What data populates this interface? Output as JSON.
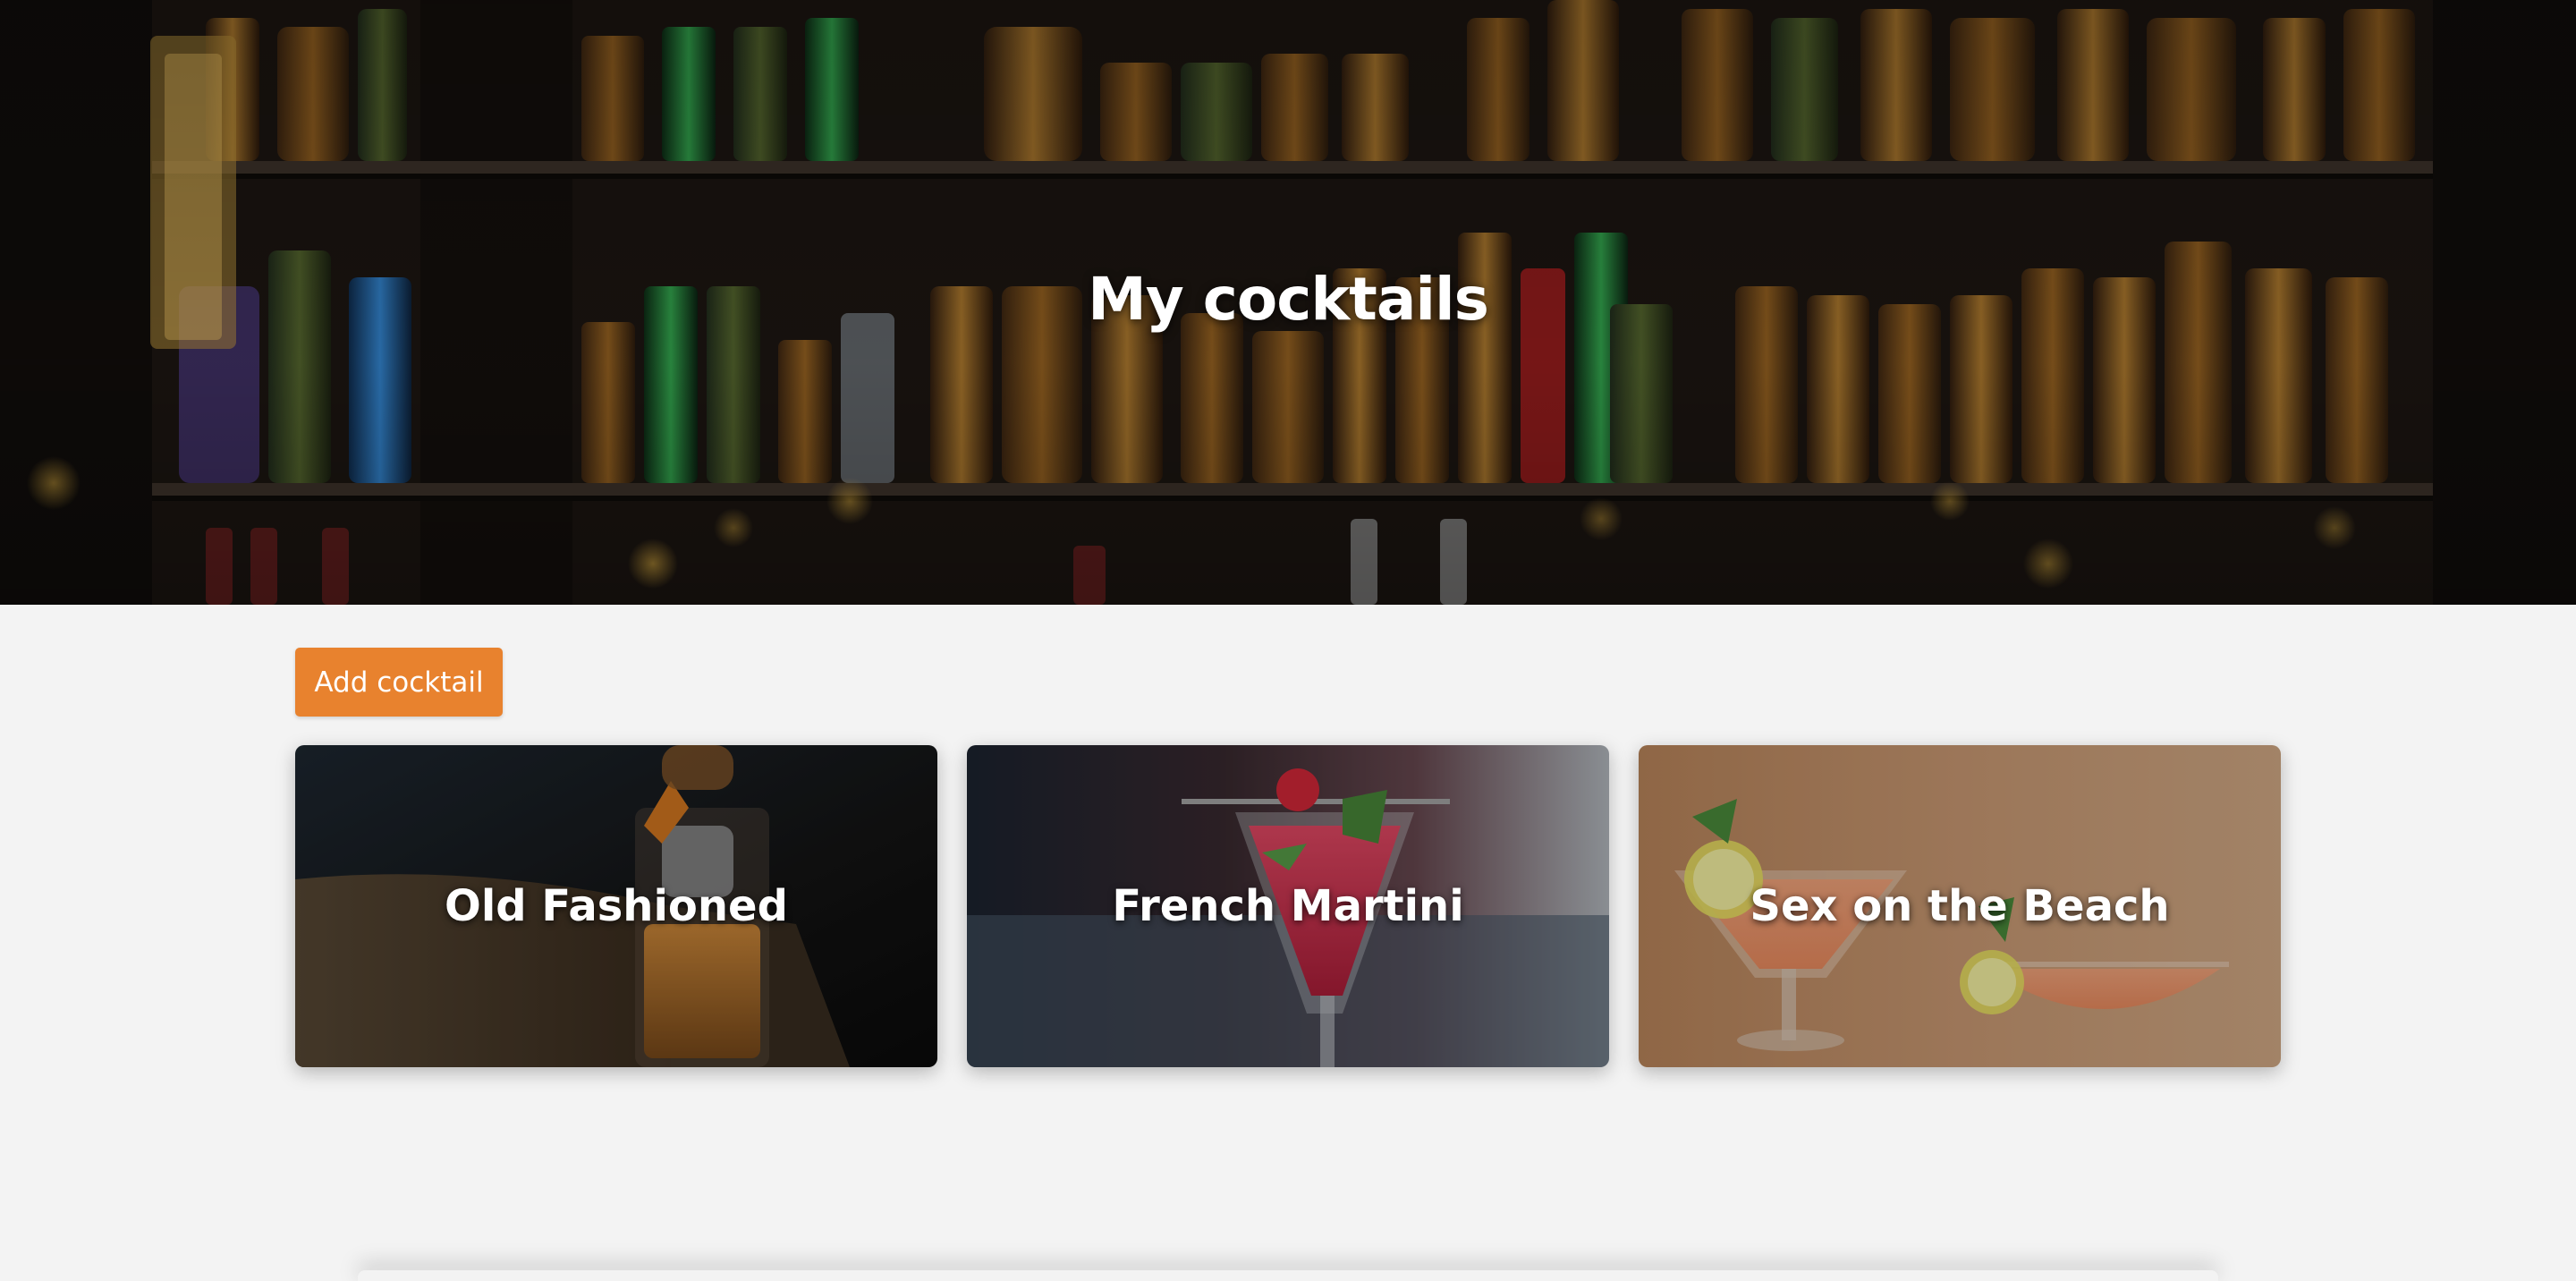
{
  "hero": {
    "title": "My cocktails"
  },
  "toolbar": {
    "add_label": "Add cocktail"
  },
  "cocktails": [
    {
      "name": "Old Fashioned"
    },
    {
      "name": "French Martini"
    },
    {
      "name": "Sex on the Beach"
    }
  ],
  "colors": {
    "accent": "#e8822e",
    "page_background": "#f3f3f3",
    "title_text": "#ffffff"
  }
}
